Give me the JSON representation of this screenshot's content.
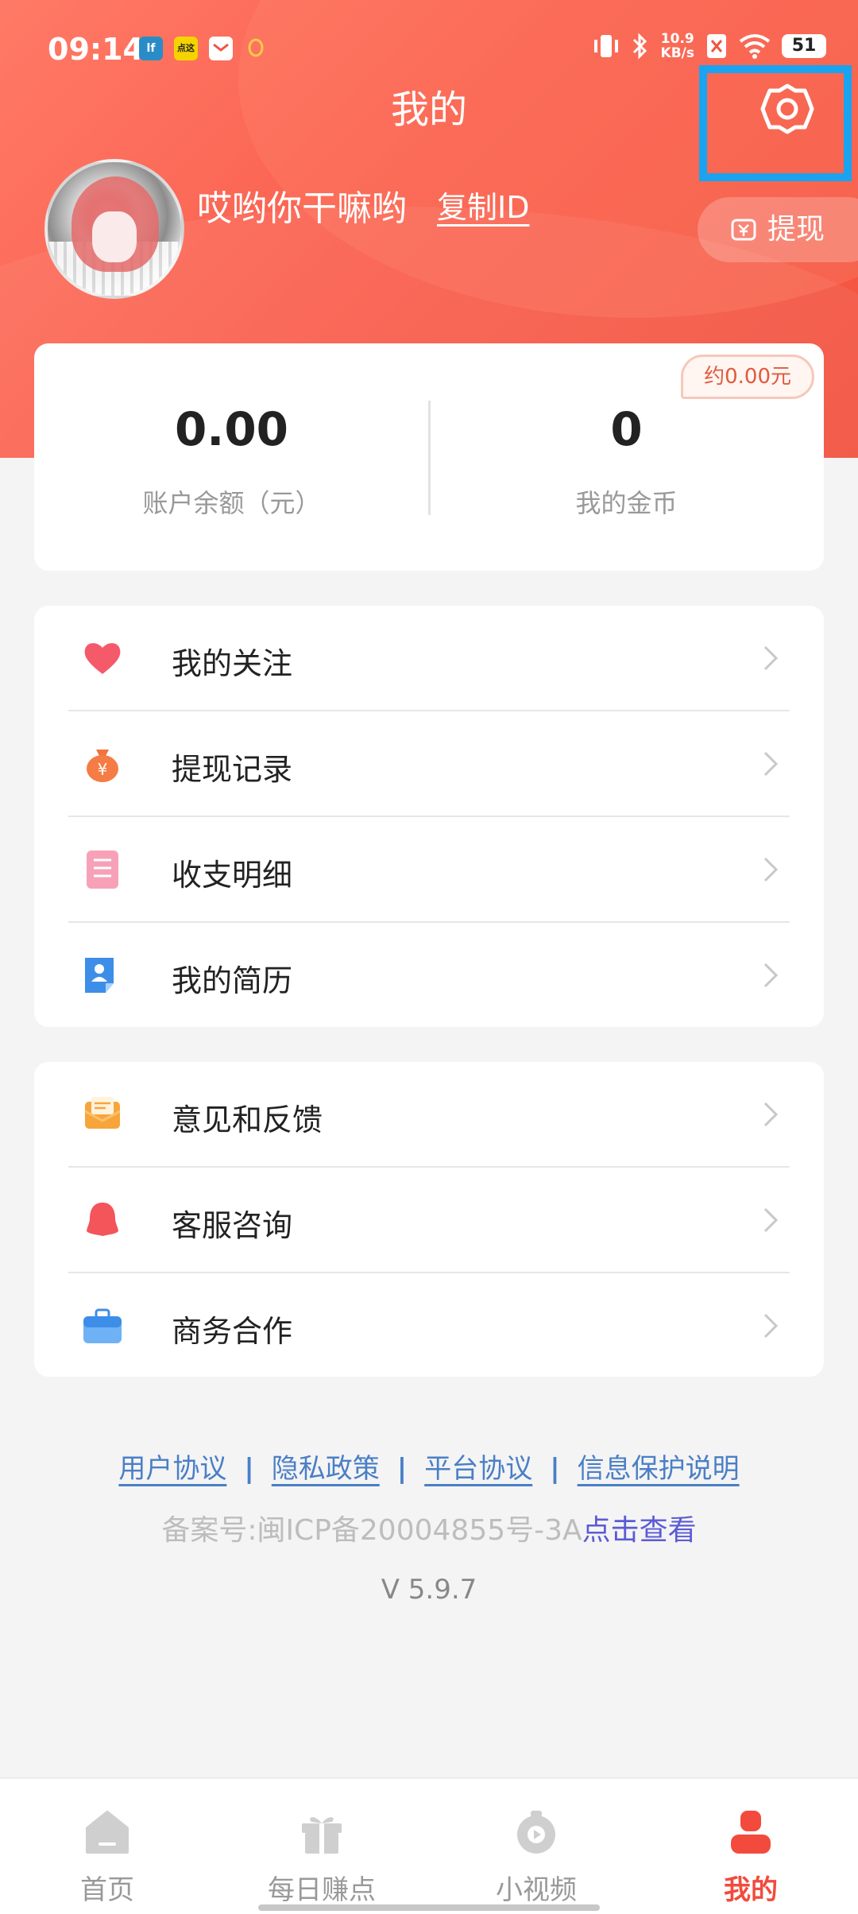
{
  "status_bar": {
    "time": "09:14",
    "app_icons": [
      "lf",
      "点这",
      "mail",
      "qq"
    ],
    "net_speed_value": "10.9",
    "net_speed_unit": "KB/s",
    "battery": "51"
  },
  "header": {
    "title": "我的",
    "settings_icon": "gear-icon"
  },
  "profile": {
    "username": "哎哟你干嘛哟",
    "copy_id_label": "复制ID",
    "withdraw_label": "提现"
  },
  "balance": {
    "account_balance": "0.00",
    "account_balance_label": "账户余额（元）",
    "coins": "0",
    "coins_label": "我的金币",
    "coins_estimate": "约0.00元"
  },
  "menu_group_1": [
    {
      "label": "我的关注",
      "icon": "heart-icon"
    },
    {
      "label": "提现记录",
      "icon": "money-bag-icon"
    },
    {
      "label": "收支明细",
      "icon": "list-icon"
    },
    {
      "label": "我的简历",
      "icon": "resume-icon"
    }
  ],
  "menu_group_2": [
    {
      "label": "意见和反馈",
      "icon": "feedback-mail-icon"
    },
    {
      "label": "客服咨询",
      "icon": "service-icon"
    },
    {
      "label": "商务合作",
      "icon": "briefcase-icon"
    }
  ],
  "footer": {
    "links": [
      "用户协议",
      "隐私政策",
      "平台协议",
      "信息保护说明"
    ],
    "separator": "|",
    "icp": "备案号:闽ICP备20004855号-3A",
    "icp_view": "点击查看",
    "version": "V 5.9.7"
  },
  "tabbar": {
    "tabs": [
      {
        "label": "首页",
        "icon": "home-icon"
      },
      {
        "label": "每日赚点",
        "icon": "gift-icon"
      },
      {
        "label": "小视频",
        "icon": "video-icon"
      },
      {
        "label": "我的",
        "icon": "person-icon"
      }
    ],
    "active_index": 3
  },
  "colors": {
    "accent": "#f24b3d",
    "header_gradient_start": "#ff7a66",
    "header_gradient_end": "#f2533f",
    "link": "#4a7fc7"
  }
}
